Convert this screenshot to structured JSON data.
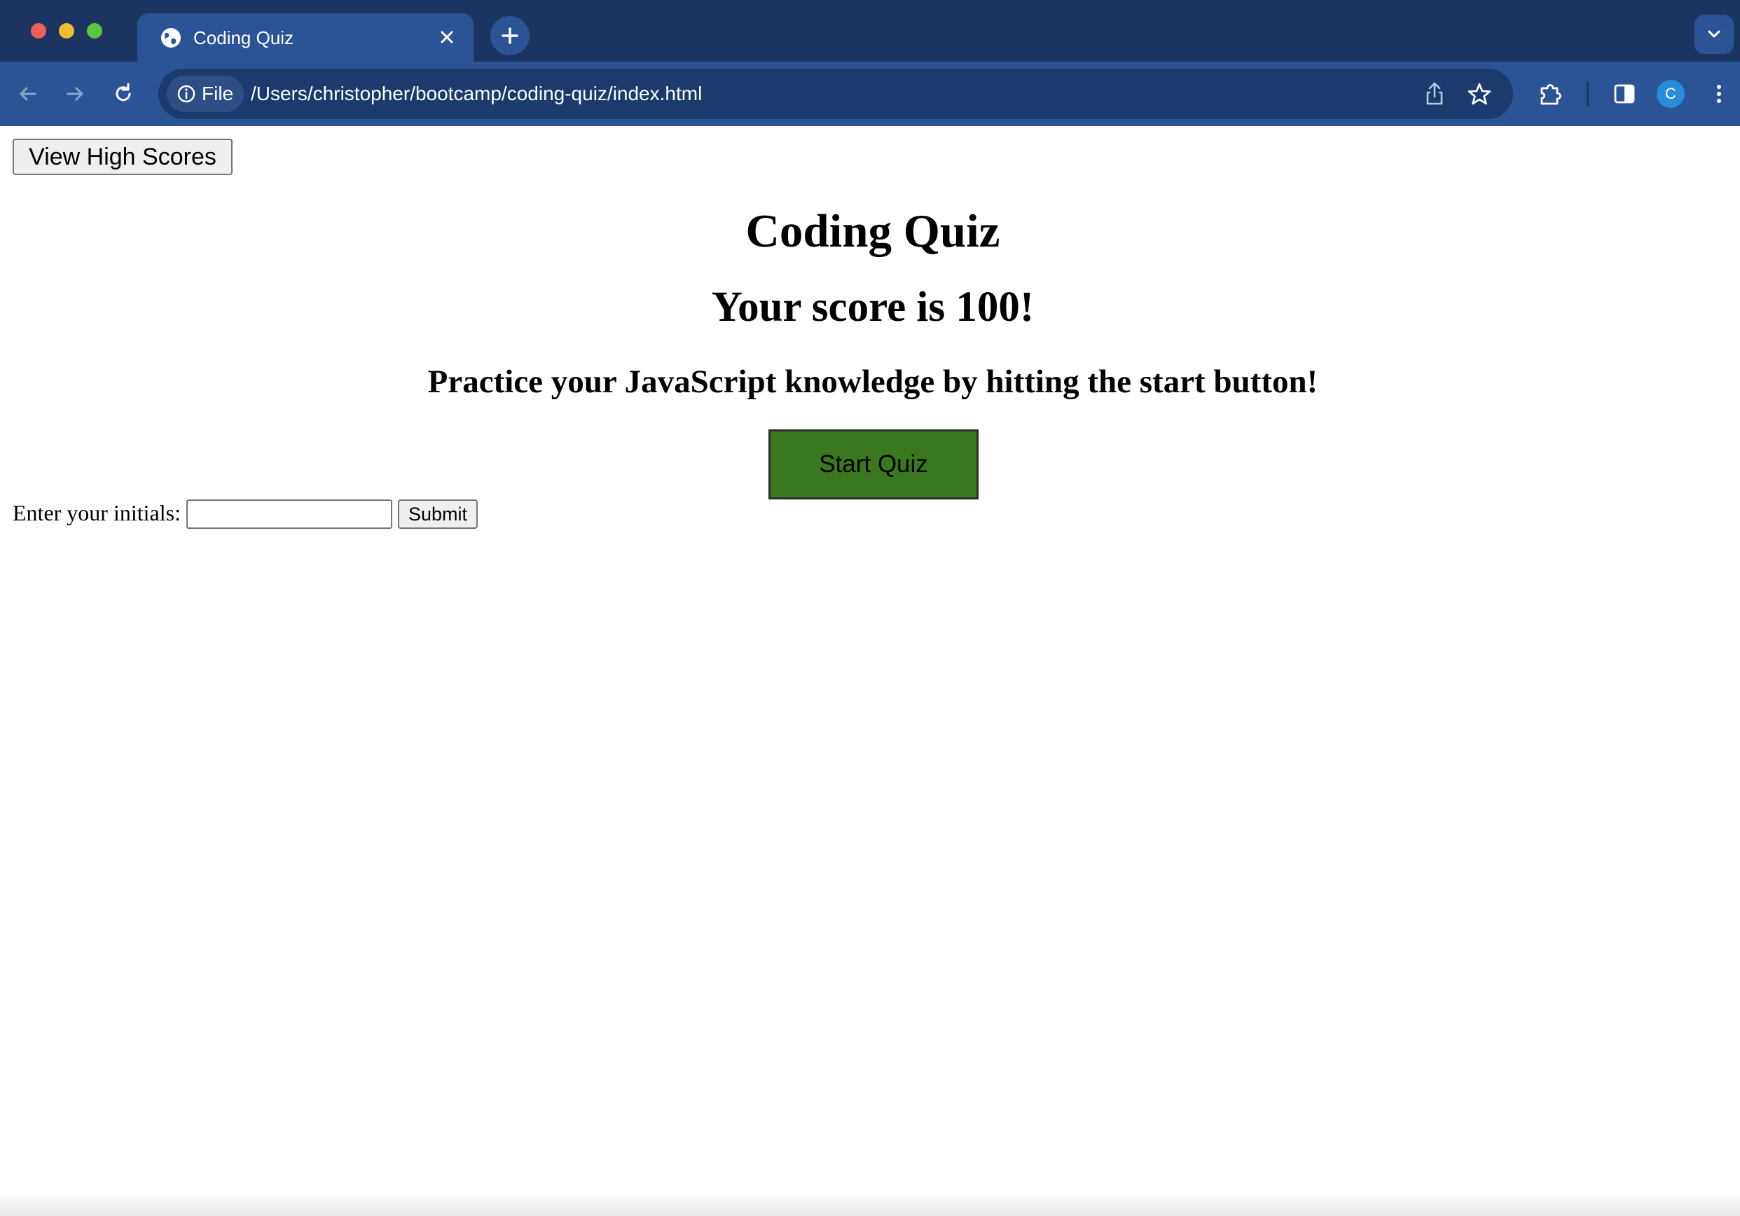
{
  "browser": {
    "tab_title": "Coding Quiz",
    "site_info_label": "File",
    "url": "/Users/christopher/bootcamp/coding-quiz/index.html",
    "profile_initial": "C"
  },
  "page": {
    "high_scores_button": "View High Scores",
    "title": "Coding Quiz",
    "score_text": "Your score is 100!",
    "subtitle": "Practice your JavaScript knowledge by hitting the start button!",
    "start_button": "Start Quiz",
    "initials_label": "Enter your initials:",
    "initials_value": "",
    "submit_button": "Submit"
  },
  "colors": {
    "chrome_dark": "#1b3461",
    "chrome_toolbar": "#2b5497",
    "start_button": "#39781f"
  },
  "icons": [
    "globe-icon",
    "close-icon",
    "plus-icon",
    "chevron-down-icon",
    "back-arrow-icon",
    "forward-arrow-icon",
    "reload-icon",
    "info-icon",
    "share-icon",
    "star-icon",
    "extensions-icon",
    "side-panel-icon",
    "more-icon"
  ]
}
